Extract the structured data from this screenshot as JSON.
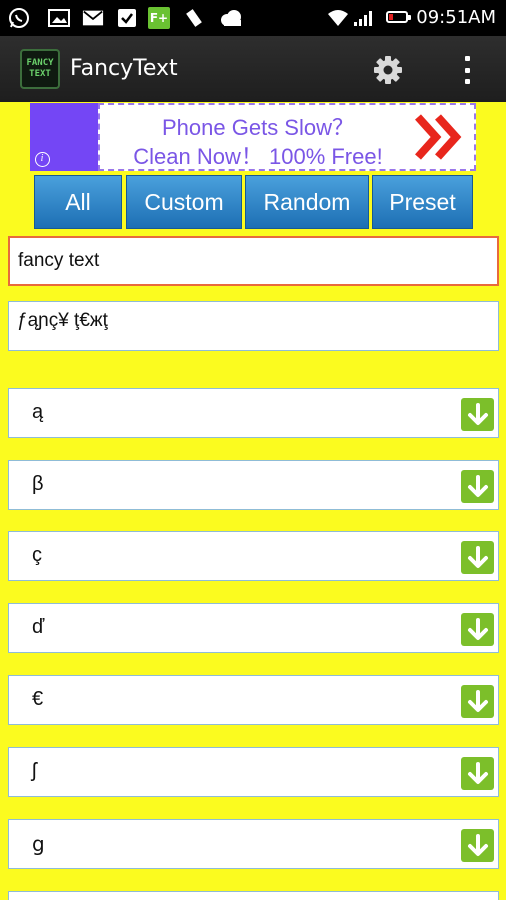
{
  "status_bar": {
    "time": "09:51AM",
    "icons": [
      "whatsapp-icon",
      "image-icon",
      "gmail-icon",
      "checklist-icon",
      "app-f-plus-icon",
      "signal-antenna-icon",
      "weather-cloud-icon",
      "wifi-icon",
      "cell-signal-icon",
      "battery-low-icon"
    ],
    "app_badge": "F+"
  },
  "action_bar": {
    "title": "FancyText",
    "logo_line1": "FANCY",
    "logo_line2": "TEXT"
  },
  "ad": {
    "line1": "Phone Gets Slow？",
    "line2": "Clean Now！ 100% Free!",
    "accent_color": "#7446f5",
    "arrow_color": "#e8261c"
  },
  "tabs": [
    {
      "label": "All"
    },
    {
      "label": "Custom"
    },
    {
      "label": "Random"
    },
    {
      "label": "Preset"
    }
  ],
  "input": {
    "value": "fancy text"
  },
  "output": {
    "value": "ƒąɲç¥ ţ€жţ"
  },
  "characters": [
    {
      "char": "ą"
    },
    {
      "char": "β"
    },
    {
      "char": "ç"
    },
    {
      "char": "ď"
    },
    {
      "char": "€"
    },
    {
      "char": "ʃ"
    },
    {
      "char": "ց"
    }
  ],
  "colors": {
    "background": "#fbfb1f",
    "tab_blue": "#2a82c9",
    "download_green": "#7cbf2a",
    "input_border": "#e86a3c"
  }
}
